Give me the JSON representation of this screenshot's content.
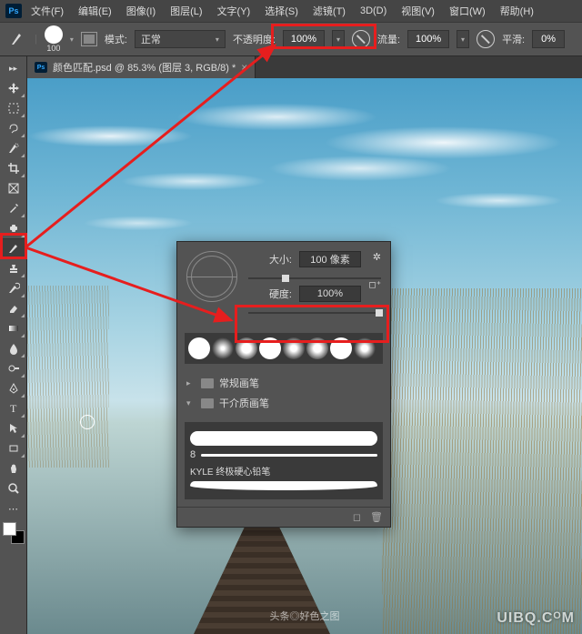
{
  "app": {
    "logo": "Ps"
  },
  "menu": {
    "file": "文件(F)",
    "edit": "编辑(E)",
    "image": "图像(I)",
    "layer": "图层(L)",
    "type": "文字(Y)",
    "select": "选择(S)",
    "filter": "滤镜(T)",
    "threeD": "3D(D)",
    "view": "视图(V)",
    "window": "窗口(W)",
    "help": "帮助(H)"
  },
  "options": {
    "brush_size": "100",
    "mode_label": "模式:",
    "mode_value": "正常",
    "opacity_label": "不透明度:",
    "opacity_value": "100%",
    "flow_label": "流量:",
    "flow_value": "100%",
    "smooth_label": "平滑:",
    "smooth_value": "0%"
  },
  "document": {
    "tab_title": "颜色匹配.psd @ 85.3% (图层 3, RGB/8) *"
  },
  "brush_panel": {
    "size_label": "大小:",
    "size_value": "100 像素",
    "hardness_label": "硬度:",
    "hardness_value": "100%",
    "folder1": "常规画笔",
    "folder2": "干介质画笔",
    "brush_num": "8",
    "brush_name": "KYLE 终极硬心铅笔"
  },
  "tools": {
    "move": "move",
    "marquee": "marquee",
    "lasso": "lasso",
    "quick": "quick-select",
    "crop": "crop",
    "frame": "frame",
    "eyedrop": "eyedropper",
    "heal": "heal",
    "brush": "brush",
    "stamp": "stamp",
    "history": "history-brush",
    "eraser": "eraser",
    "gradient": "gradient",
    "blur": "blur",
    "dodge": "dodge",
    "pen": "pen",
    "type": "type",
    "path": "path-select",
    "rect": "rectangle",
    "hand": "hand",
    "zoom": "zoom",
    "more": "more"
  },
  "watermark": "UIBQ.CᴼM",
  "small_watermark": "头条◎好色之图"
}
